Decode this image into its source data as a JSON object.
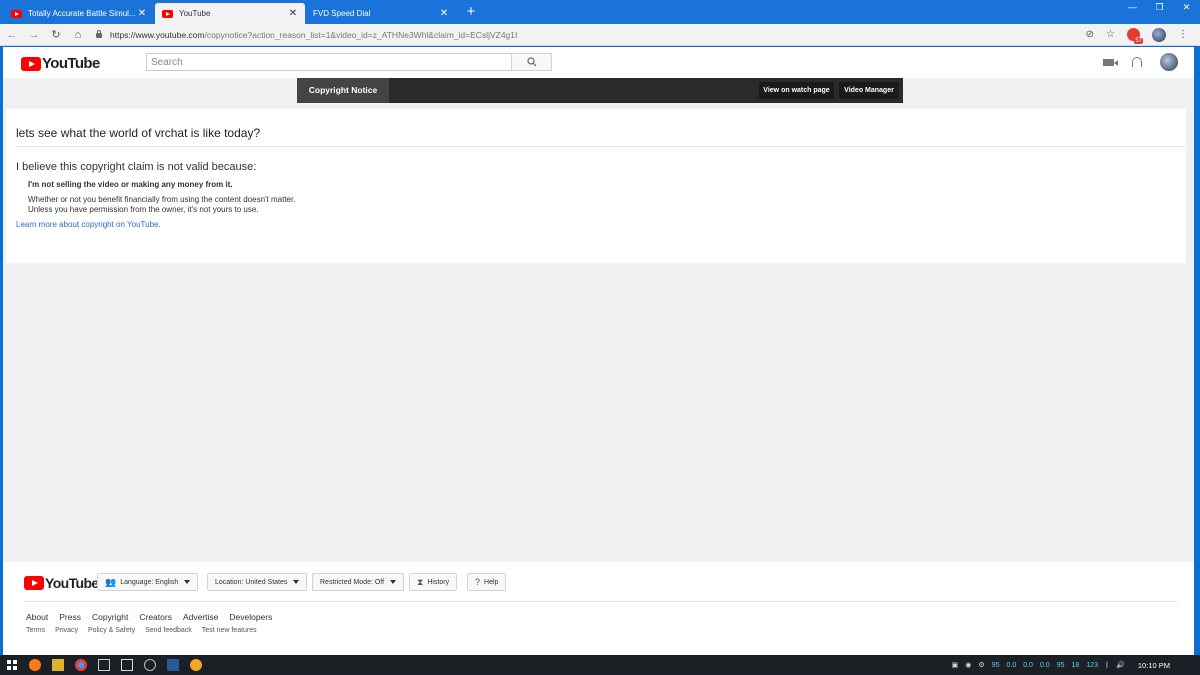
{
  "browser": {
    "tabs": [
      {
        "label": "Totally Accurate Battle Simul...",
        "active": false,
        "icon": "youtube-icon"
      },
      {
        "label": "YouTube",
        "active": true,
        "icon": "youtube-icon"
      },
      {
        "label": "FVD Speed Dial",
        "active": false,
        "icon": "none"
      }
    ],
    "new_tab": "+",
    "close": "✕",
    "window_controls": [
      "—",
      "❐",
      "✕"
    ],
    "url_scheme": "https://www.youtube.com",
    "url_rest": "/copynotice?action_reason_list=1&video_id=z_ATHNe3Whl&claim_id=ECsljVZ4g1I",
    "ext_badge": "57"
  },
  "masthead": {
    "logo_text": "YouTube",
    "search_placeholder": "Search"
  },
  "notice_bar": {
    "title": "Copyright Notice",
    "view_watch": "View on watch page",
    "video_manager": "Video Manager"
  },
  "content": {
    "video_title": "lets see what the world of vrchat is like today?",
    "claim_heading": "I believe this copyright claim is not valid because:",
    "reason": "I'm not selling the video or making any money from it.",
    "explain_1": "Whether or not you benefit financially from using the content doesn't matter.",
    "explain_2": "Unless you have permission from the owner, it's not yours to use.",
    "learn_more": "Learn more about copyright on YouTube."
  },
  "footer": {
    "logo_text": "YouTube",
    "language": "Language: English",
    "location": "Location: United States",
    "restricted": "Restricted Mode: Off",
    "history": "History",
    "help": "Help",
    "links_primary": [
      "About",
      "Press",
      "Copyright",
      "Creators",
      "Advertise",
      "Developers"
    ],
    "links_secondary": [
      "Terms",
      "Privacy",
      "Policy & Safety",
      "Send feedback",
      "Test new features"
    ]
  },
  "taskbar": {
    "tray_values": [
      "95",
      "0.0",
      "0.0",
      "0.0",
      "95",
      "18",
      "123"
    ],
    "clock": "10:10 PM"
  },
  "colors": {
    "brand_red": "#ff0000",
    "link_blue": "#2a6fc9",
    "titlebar_blue": "#1a73d8"
  }
}
